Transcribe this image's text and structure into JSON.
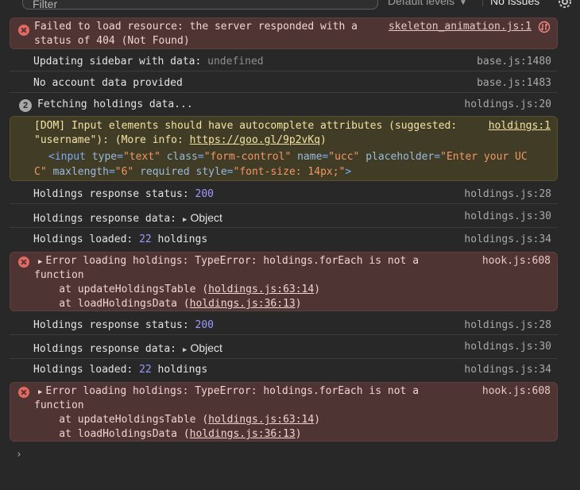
{
  "toolbar": {
    "filter_placeholder": "Filter",
    "levels_label": "Default levels",
    "issues_label": "No Issues"
  },
  "messages": [
    {
      "type": "error",
      "text_line1": "Failed to load resource: the server responded with a",
      "text_line2": "status of 404 (Not Found)",
      "source": "skeleton_animation.js:1"
    },
    {
      "type": "log",
      "text": "Updating sidebar with data:",
      "value": "undefined",
      "source": "base.js:1480"
    },
    {
      "type": "log",
      "text": "No account data provided",
      "source": "base.js:1483"
    },
    {
      "type": "log",
      "count": "2",
      "text": "Fetching holdings data...",
      "source": "holdings.js:20"
    },
    {
      "type": "warning",
      "text_line1": "[DOM] Input elements should have autocomplete attributes (suggested:",
      "text_line2_a": "\"username\"): (More info: ",
      "text_line2_link": "https://goo.gl/9p2vKq",
      "text_line2_b": ")",
      "source": "holdings:1",
      "snippet": {
        "open": "<input",
        "attr1_name": "type",
        "attr1_value": "\"text\"",
        "attr2_name": "class",
        "attr2_value": "\"form-control\"",
        "attr3_name": "name",
        "attr3_value": "\"ucc\"",
        "attr4_name": "placeholder",
        "attr4_value_a": "\"Enter your UC",
        "attr4_value_b": "C\"",
        "attr5_name": "maxlength",
        "attr5_value": "\"6\"",
        "attr6": "required",
        "attr7_name": "style",
        "attr7_value": "\"font-size: 14px;\"",
        "close": ">"
      }
    },
    {
      "type": "log",
      "text": "Holdings response status:",
      "value": "200",
      "source": "holdings.js:28"
    },
    {
      "type": "log",
      "text": "Holdings response data:",
      "value": "Object",
      "source": "holdings.js:30"
    },
    {
      "type": "log",
      "text_a": "Holdings loaded:",
      "value": "22",
      "text_b": "holdings",
      "source": "holdings.js:34"
    },
    {
      "type": "error",
      "text_line1": "Error loading holdings: TypeError: holdings.forEach is not a",
      "text_line2": "function",
      "stack": [
        {
          "prefix": "    at updateHoldingsTable (",
          "link": "holdings.js:63:14",
          "suffix": ")"
        },
        {
          "prefix": "    at loadHoldingsData (",
          "link": "holdings.js:36:13",
          "suffix": ")"
        }
      ],
      "source": "hook.js:608"
    },
    {
      "type": "log",
      "text": "Holdings response status:",
      "value": "200",
      "source": "holdings.js:28"
    },
    {
      "type": "log",
      "text": "Holdings response data:",
      "value": "Object",
      "source": "holdings.js:30"
    },
    {
      "type": "log",
      "text_a": "Holdings loaded:",
      "value": "22",
      "text_b": "holdings",
      "source": "holdings.js:34"
    },
    {
      "type": "error",
      "text_line1": "Error loading holdings: TypeError: holdings.forEach is not a",
      "text_line2": "function",
      "stack": [
        {
          "prefix": "    at updateHoldingsTable (",
          "link": "holdings.js:63:14",
          "suffix": ")"
        },
        {
          "prefix": "    at loadHoldingsData (",
          "link": "holdings.js:36:13",
          "suffix": ")"
        }
      ],
      "source": "hook.js:608"
    }
  ],
  "prompt_symbol": "›",
  "colors": {
    "background": "#282828",
    "error_bg": "#4e3534",
    "warning_bg": "#413c26",
    "number": "#9d99ff",
    "attr_value": "#f29766"
  },
  "icons": {
    "error": "error-circle-icon",
    "network": "network-request-icon",
    "settings": "gear-icon"
  }
}
